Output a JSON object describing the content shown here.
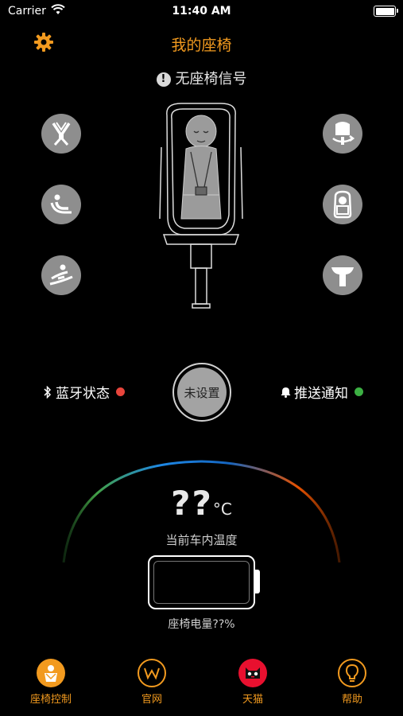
{
  "status_bar": {
    "carrier": "Carrier",
    "time": "11:40 AM"
  },
  "header": {
    "title": "我的座椅",
    "settings_icon": "gear-icon"
  },
  "signal": {
    "icon": "exclamation-icon",
    "text": "无座椅信号"
  },
  "features_left": [
    {
      "icon": "harness-icon"
    },
    {
      "icon": "recline-icon"
    },
    {
      "icon": "isofix-icon"
    }
  ],
  "features_right": [
    {
      "icon": "rotate-seat-icon"
    },
    {
      "icon": "headrest-icon"
    },
    {
      "icon": "support-leg-icon"
    }
  ],
  "bluetooth": {
    "label": "蓝牙状态",
    "status_color": "#e8453c"
  },
  "center_button": {
    "label": "未设置"
  },
  "push": {
    "label": "推送通知",
    "status_color": "#3cb043"
  },
  "temperature": {
    "value": "??",
    "unit": "°C",
    "label": "当前车内温度"
  },
  "battery": {
    "label": "座椅电量??%"
  },
  "tabs": [
    {
      "label": "座椅控制",
      "icon": "baby-seat-icon",
      "active": true
    },
    {
      "label": "官网",
      "icon": "website-logo-icon"
    },
    {
      "label": "天猫",
      "icon": "tmall-icon"
    },
    {
      "label": "帮助",
      "icon": "lightbulb-icon"
    }
  ],
  "colors": {
    "accent": "#f29a1f",
    "button_gray": "#8e8e8e",
    "tmall_red": "#e8102f"
  }
}
